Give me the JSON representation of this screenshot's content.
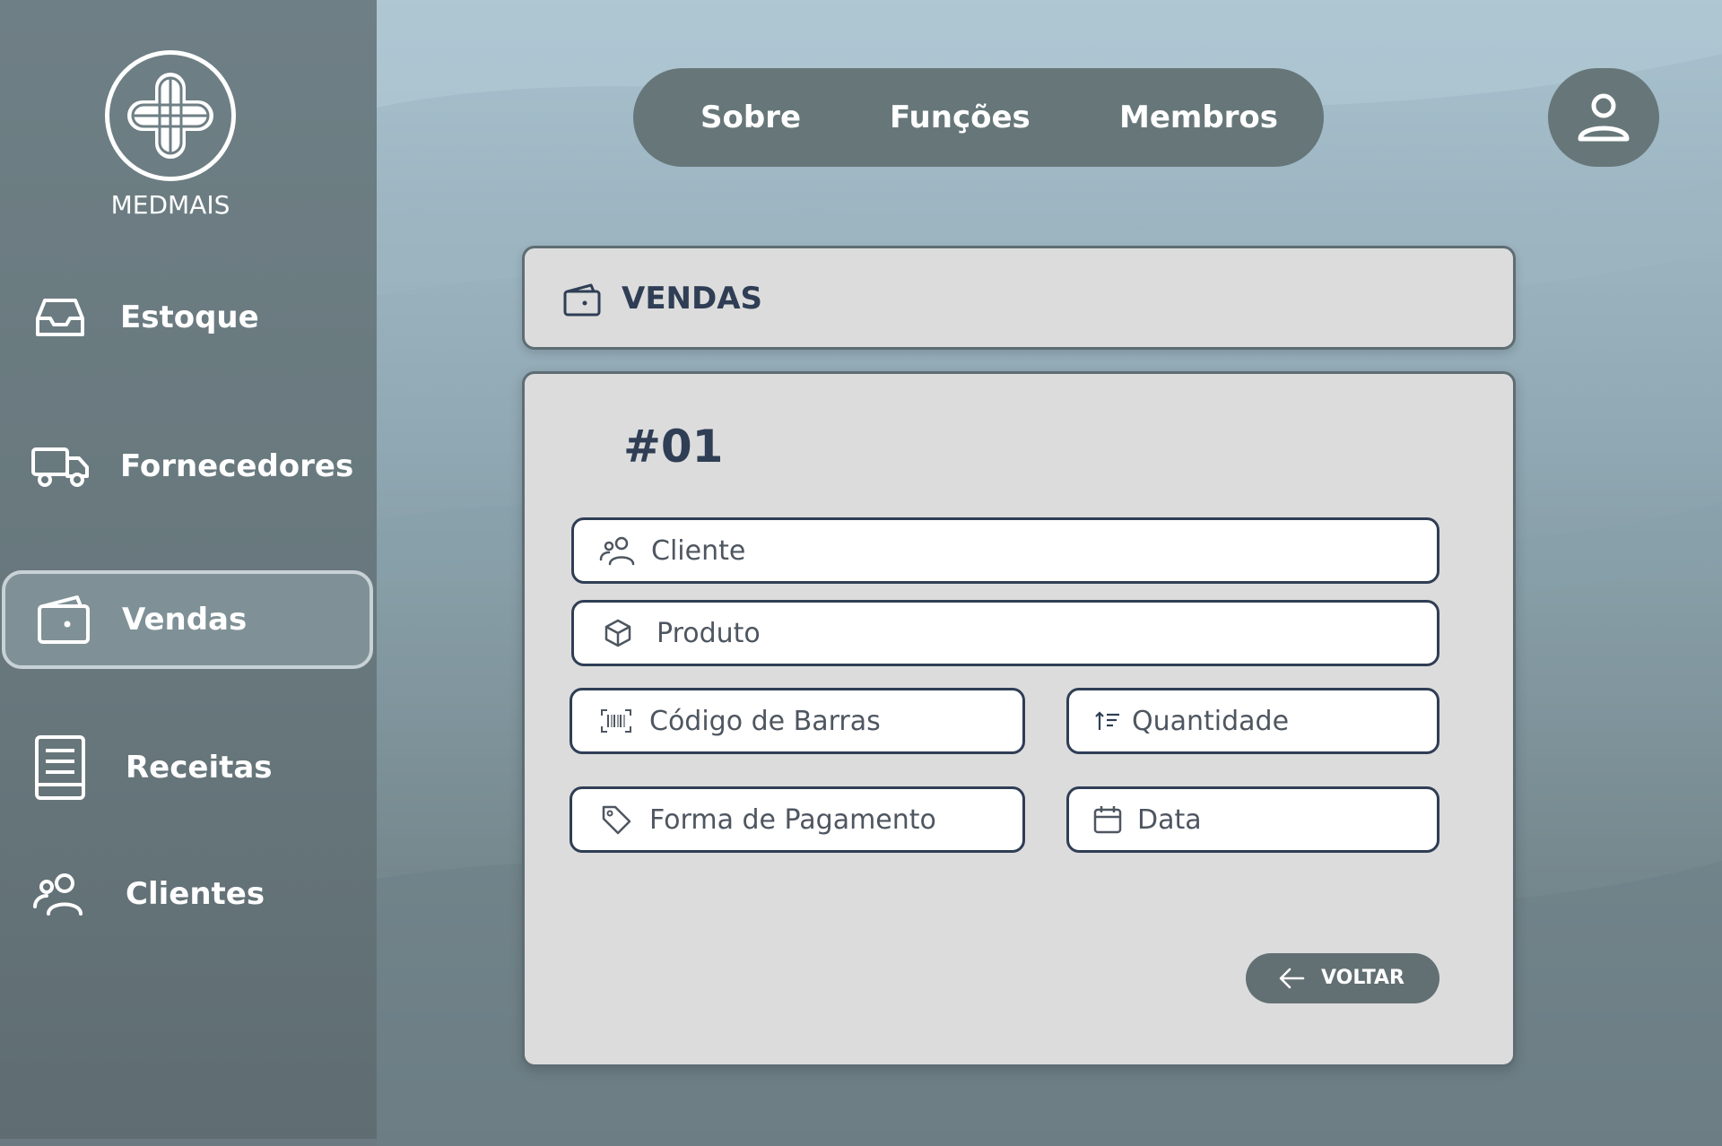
{
  "app": {
    "logo_text": "MEDMAIS"
  },
  "sidebar": {
    "items": [
      {
        "label": "Estoque",
        "icon": "inbox-icon",
        "active": false
      },
      {
        "label": "Fornecedores",
        "icon": "truck-icon",
        "active": false
      },
      {
        "label": "Vendas",
        "icon": "wallet-icon",
        "active": true
      },
      {
        "label": "Receitas",
        "icon": "book-icon",
        "active": false
      },
      {
        "label": "Clientes",
        "icon": "users-icon",
        "active": false
      }
    ]
  },
  "topnav": {
    "items": [
      "Sobre",
      "Funções",
      "Membros"
    ],
    "user_icon": "user-icon"
  },
  "panel": {
    "title": "VENDAS",
    "title_icon": "wallet-icon",
    "order_number": "#01",
    "fields": {
      "cliente": {
        "placeholder": "Cliente",
        "icon": "users-icon"
      },
      "produto": {
        "placeholder": "Produto",
        "icon": "box-icon"
      },
      "codigo": {
        "placeholder": "Código de Barras",
        "icon": "barcode-icon"
      },
      "quantidade": {
        "placeholder": "Quantidade",
        "icon": "sort-icon"
      },
      "pagamento": {
        "placeholder": "Forma de Pagamento",
        "icon": "tag-icon"
      },
      "data": {
        "placeholder": "Data",
        "icon": "calendar-icon"
      }
    },
    "back_button": "VOLTAR"
  },
  "colors": {
    "sidebar": "#67777c",
    "pill": "#677779",
    "panel": "#dcdcdc",
    "text_dark": "#2f3e55",
    "button": "#626f73"
  }
}
